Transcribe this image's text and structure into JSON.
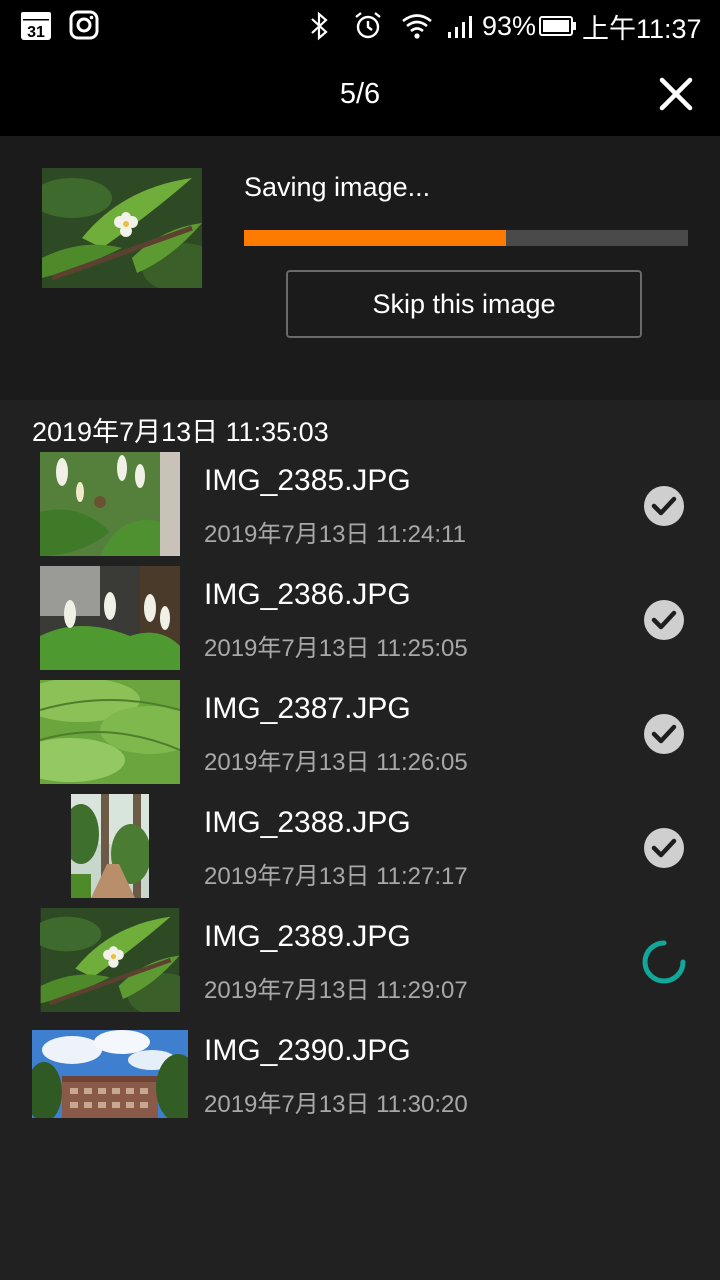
{
  "status_bar": {
    "battery": "93%",
    "time": "上午11:37",
    "calendar_day": "31",
    "icons": [
      "calendar-icon",
      "instagram-icon",
      "bluetooth-icon",
      "alarm-icon",
      "wifi-icon",
      "signal-icon",
      "battery-icon"
    ]
  },
  "header": {
    "title": "5/6",
    "close_icon": "close-icon"
  },
  "saving": {
    "text": "Saving image...",
    "progress": 0.59,
    "skip_label": "Skip this image",
    "colors": {
      "progress_fill": "#ff7a00",
      "progress_track": "#4a4a4a"
    }
  },
  "list": {
    "group_date": "2019年7月13日 11:35:03",
    "items": [
      {
        "name": "IMG_2385.JPG",
        "time": "2019年7月13日 11:24:11",
        "status": "done"
      },
      {
        "name": "IMG_2386.JPG",
        "time": "2019年7月13日 11:25:05",
        "status": "done"
      },
      {
        "name": "IMG_2387.JPG",
        "time": "2019年7月13日 11:26:05",
        "status": "done"
      },
      {
        "name": "IMG_2388.JPG",
        "time": "2019年7月13日 11:27:17",
        "status": "done"
      },
      {
        "name": "IMG_2389.JPG",
        "time": "2019年7月13日 11:29:07",
        "status": "in-progress"
      },
      {
        "name": "IMG_2390.JPG",
        "time": "2019年7月13日 11:30:20",
        "status": "pending"
      }
    ],
    "colors": {
      "check": "#cfcfcf",
      "spinner": "#12a79b"
    }
  }
}
